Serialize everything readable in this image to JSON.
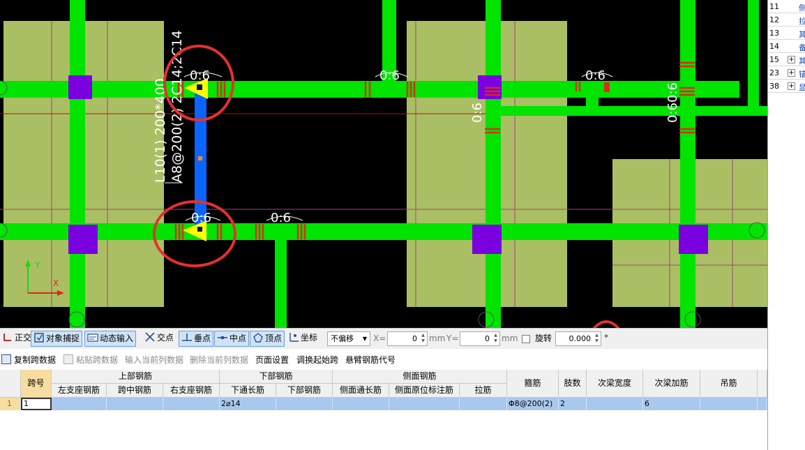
{
  "cad": {
    "beam_label_1": "L10(1)  200*400",
    "beam_label_2": "A8@200(2)  2C14;2C14",
    "stirrup_marks": [
      "0:6",
      "0:6",
      "0:6",
      "0:6",
      "0:60:6",
      "0:6",
      "0:6",
      "0:6"
    ],
    "axis_x": "X",
    "axis_y": "Y",
    "colors": {
      "beam": "#00e400",
      "slab": "#aabf63",
      "column": "#7a00e0",
      "selected_beam": "#0a64ff",
      "rebar_mark": "#e0281c",
      "marker": "#ffff00"
    }
  },
  "props": [
    {
      "num": "11",
      "expand": "",
      "label": "侧"
    },
    {
      "num": "12",
      "expand": "",
      "label": "拉"
    },
    {
      "num": "13",
      "expand": "",
      "label": "其"
    },
    {
      "num": "14",
      "expand": "",
      "label": "备"
    },
    {
      "num": "15",
      "expand": "+",
      "label": "其"
    },
    {
      "num": "23",
      "expand": "+",
      "label": "锚"
    },
    {
      "num": "38",
      "expand": "+",
      "label": "显"
    }
  ],
  "snap": {
    "ortho": "正交",
    "object_snap": "对象捕捉",
    "dynamic_input": "动态输入",
    "intersection": "交点",
    "perpendicular": "垂点",
    "midpoint": "中点",
    "vertex": "顶点",
    "coordinate": "坐标",
    "offset_select": "不偏移",
    "x_label": "X=",
    "x_value": "0",
    "unit1": "mm",
    "y_label": "Y=",
    "y_value": "0",
    "unit2": "mm",
    "rotate_label": "旋转",
    "rotate_value": "0.000",
    "degree": "°"
  },
  "actions": {
    "copy_span": "复制跨数据",
    "paste_span": "粘贴跨数据",
    "input_column": "输入当前列数据",
    "delete_column": "删除当前列数据",
    "page_setup": "页面设置",
    "swap_start": "调换起始跨",
    "cantilever_code": "悬臂钢筋代号"
  },
  "table": {
    "group_top": "上部钢筋",
    "group_bottom": "下部钢筋",
    "group_side": "侧面钢筋",
    "col_span": "跨号",
    "col_left_support": "左支座钢筋",
    "col_mid_span": "跨中钢筋",
    "col_right_support": "右支座钢筋",
    "col_bottom_through": "下通长筋",
    "col_bottom": "下部钢筋",
    "col_side_through": "侧面通长筋",
    "col_side_origin": "侧面原位标注筋",
    "col_tie": "拉筋",
    "col_stirrup": "箍筋",
    "col_legs": "肢数",
    "col_sec_width": "次梁宽度",
    "col_sec_add": "次梁加筋",
    "col_hanger": "吊筋",
    "row": {
      "index": "1",
      "span": "1",
      "left_support": "",
      "mid_span": "",
      "right_support": "",
      "bottom_through": "2⌀14",
      "bottom": "",
      "side_through": "",
      "side_origin": "",
      "tie": "",
      "stirrup": "Φ8@200(2)",
      "legs": "2",
      "sec_width": "",
      "sec_add": "6",
      "hanger": ""
    }
  }
}
